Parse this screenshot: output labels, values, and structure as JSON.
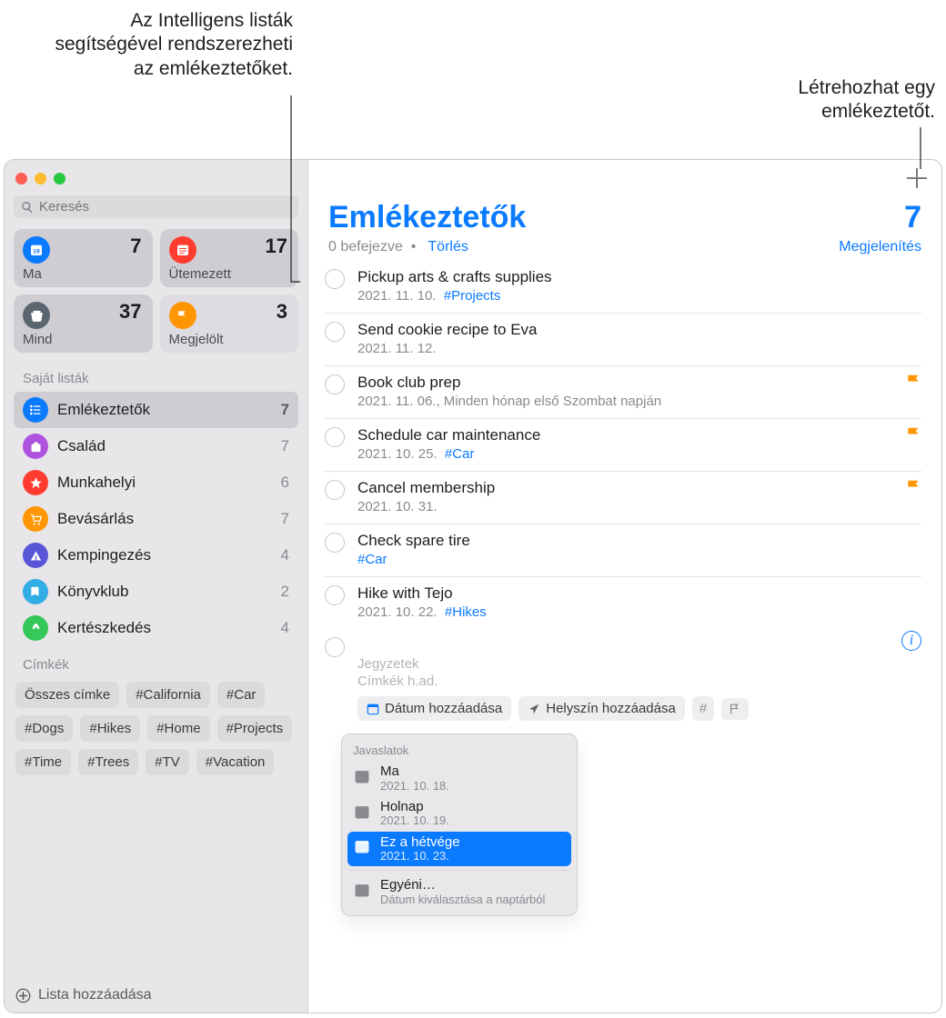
{
  "callouts": {
    "smartlists": "Az Intelligens listák segítségével rendszerezheti az emlékeztetőket.",
    "add": "Létrehozhat egy emlékeztetőt."
  },
  "search": {
    "placeholder": "Keresés"
  },
  "smart_cards": [
    {
      "id": "today",
      "label": "Ma",
      "count": "7",
      "color": "#0a7aff",
      "light": false
    },
    {
      "id": "scheduled",
      "label": "Ütemezett",
      "count": "17",
      "color": "#ff3b30",
      "light": false
    },
    {
      "id": "all",
      "label": "Mind",
      "count": "37",
      "color": "#5b6670",
      "light": false
    },
    {
      "id": "flagged",
      "label": "Megjelölt",
      "count": "3",
      "color": "#ff9500",
      "light": true
    }
  ],
  "sidebar": {
    "my_lists_header": "Saját listák",
    "lists": [
      {
        "id": "reminders",
        "label": "Emlékeztetők",
        "count": "7",
        "color": "#0a7aff",
        "selected": true
      },
      {
        "id": "family",
        "label": "Család",
        "count": "7",
        "color": "#af52de"
      },
      {
        "id": "work",
        "label": "Munkahelyi",
        "count": "6",
        "color": "#ff3b30"
      },
      {
        "id": "shopping",
        "label": "Bevásárlás",
        "count": "7",
        "color": "#ff9500"
      },
      {
        "id": "camping",
        "label": "Kempingezés",
        "count": "4",
        "color": "#5856d6"
      },
      {
        "id": "bookclub",
        "label": "Könyvklub",
        "count": "2",
        "color": "#32ade6"
      },
      {
        "id": "gardening",
        "label": "Kertészkedés",
        "count": "4",
        "color": "#34c759"
      }
    ],
    "tags_header": "Címkék",
    "tags": [
      "Összes címke",
      "#California",
      "#Car",
      "#Dogs",
      "#Hikes",
      "#Home",
      "#Projects",
      "#Time",
      "#Trees",
      "#TV",
      "#Vacation"
    ],
    "add_list": "Lista hozzáadása"
  },
  "main": {
    "title": "Emlékeztetők",
    "count": "7",
    "completed_text": "0 befejezve",
    "dot": "•",
    "clear_text": "Törlés",
    "show_text": "Megjelenítés"
  },
  "reminders": [
    {
      "title": "Pickup arts & crafts supplies",
      "date": "2021. 11. 10.",
      "hash": "#Projects"
    },
    {
      "title": "Send cookie recipe to Eva",
      "date": "2021. 11. 12."
    },
    {
      "title": "Book club prep",
      "date": "2021. 11. 06., Minden hónap első Szombat napján",
      "flag": true
    },
    {
      "title": "Schedule car maintenance",
      "date": "2021. 10. 25.",
      "hash": "#Car",
      "flag": true
    },
    {
      "title": "Cancel membership",
      "date": "2021. 10. 31.",
      "flag": true
    },
    {
      "title": "Check spare tire",
      "hash_only": "#Car"
    },
    {
      "title": "Hike with Tejo",
      "date": "2021. 10. 22.",
      "hash": "#Hikes"
    }
  ],
  "new_item": {
    "notes_placeholder": "Jegyzetek",
    "tags_placeholder": "Címkék h.ad.",
    "add_date": "Dátum hozzáadása",
    "add_location": "Helyszín hozzáadása"
  },
  "suggestions": {
    "header": "Javaslatok",
    "items": [
      {
        "t1": "Ma",
        "t2": "2021. 10. 18."
      },
      {
        "t1": "Holnap",
        "t2": "2021. 10. 19."
      },
      {
        "t1": "Ez a hétvége",
        "t2": "2021. 10. 23.",
        "selected": true
      },
      {
        "t1": "Egyéni…",
        "t2": "Dátum kiválasztása a naptárból",
        "divider_before": true
      }
    ]
  }
}
